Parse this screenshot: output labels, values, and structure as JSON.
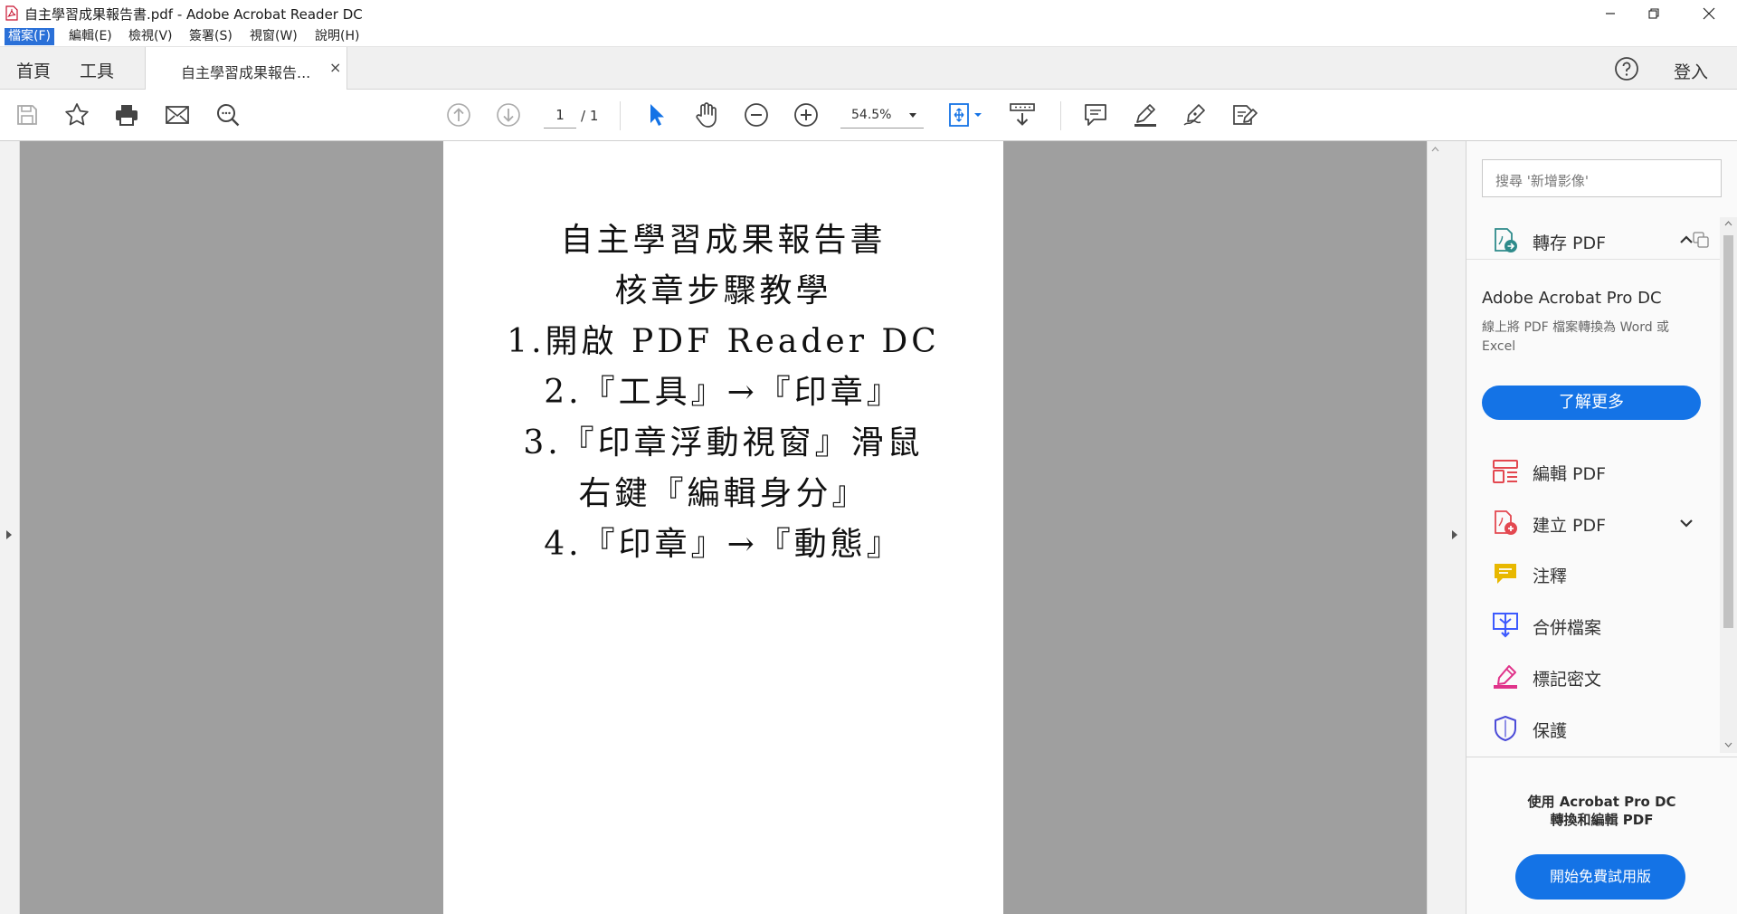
{
  "window": {
    "title": "自主學習成果報告書.pdf - Adobe Acrobat Reader DC"
  },
  "menu": [
    {
      "label": "檔案(F)",
      "active": true
    },
    {
      "label": "編輯(E)"
    },
    {
      "label": "檢視(V)"
    },
    {
      "label": "簽署(S)"
    },
    {
      "label": "視窗(W)"
    },
    {
      "label": "說明(H)"
    }
  ],
  "tabs": {
    "home": "首頁",
    "tools": "工具",
    "document": "自主學習成果報告...",
    "close": "×",
    "signin": "登入"
  },
  "toolbar": {
    "page_current": "1",
    "page_total": "/ 1",
    "zoom": "54.5%"
  },
  "document": {
    "lines": [
      "自主學習成果報告書",
      "核章步驟教學",
      "1.開啟 PDF Reader DC",
      "2.『工具』→『印章』",
      "3.『印章浮動視窗』滑鼠",
      "右鍵『編輯身分』",
      "4.『印章』→『動態』"
    ]
  },
  "right_panel": {
    "search_placeholder": "搜尋 '新增影像'",
    "export_pdf": "轉存 PDF",
    "promo_title": "Adobe Acrobat Pro DC",
    "promo_desc": "線上將 PDF 檔案轉換為 Word 或 Excel",
    "learn_more": "了解更多",
    "tools": [
      {
        "label": "編輯 PDF",
        "icon": "edit-pdf-icon",
        "color": "#e34850"
      },
      {
        "label": "建立 PDF",
        "icon": "create-pdf-icon",
        "color": "#e34850"
      },
      {
        "label": "注釋",
        "icon": "comment-icon",
        "color": "#e8b800"
      },
      {
        "label": "合併檔案",
        "icon": "combine-files-icon",
        "color": "#3d5afe"
      },
      {
        "label": "標記密文",
        "icon": "redact-icon",
        "color": "#e0338a"
      },
      {
        "label": "保護",
        "icon": "protect-icon",
        "color": "#4b4bd8"
      }
    ],
    "footer_line1": "使用 Acrobat Pro DC",
    "footer_line2": "轉換和編輯 PDF",
    "trial": "開始免費試用版"
  },
  "colors": {
    "accent": "#1473e6",
    "menu_active": "#2a70d8",
    "viewer_bg": "#9f9f9f"
  }
}
